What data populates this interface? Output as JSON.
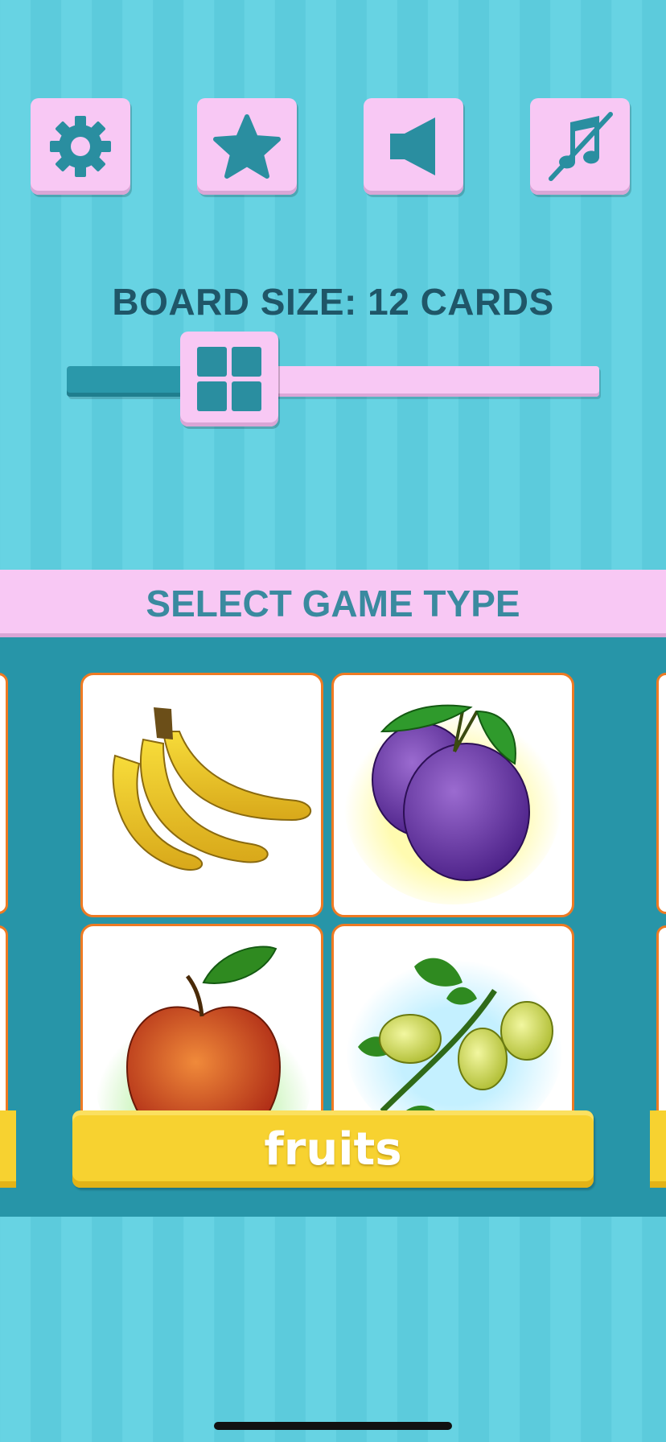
{
  "toolbar": {
    "settings_icon": "gear-icon",
    "rate_icon": "star-icon",
    "sound_icon": "speaker-icon",
    "music_icon": "music-off-icon"
  },
  "board": {
    "label": "BOARD SIZE:  12  CARDS",
    "slider_level": 0.23,
    "thumb_icon": "grid-icon"
  },
  "game_type": {
    "title": "SELECT GAME TYPE",
    "selected": {
      "label": "fruits",
      "cards": [
        "banana",
        "plum",
        "apple",
        "gooseberry"
      ]
    }
  },
  "colors": {
    "background": "#67d3e3",
    "button_pink": "#f8c8f4",
    "icon_teal": "#2a8ea0",
    "carousel_bg": "#2795a8",
    "label_yellow": "#f7d230",
    "card_border": "#ee7a23"
  }
}
